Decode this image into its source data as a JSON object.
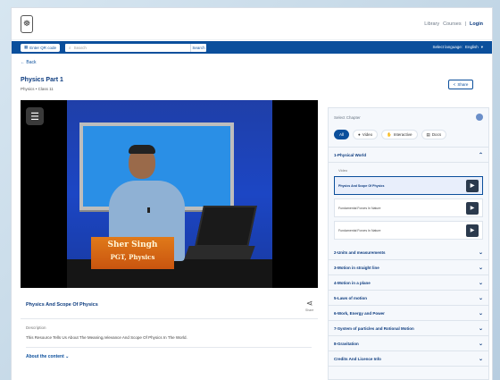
{
  "header": {
    "emblem": "☸",
    "links": [
      "Library",
      "Courses"
    ],
    "login": "Login",
    "separator": "|"
  },
  "searchbar": {
    "qr_label": "Enter QR code",
    "search_placeholder": "Search",
    "search_button": "Search",
    "language_label": "Select language:",
    "language_value": "English"
  },
  "nav": {
    "back": "Back"
  },
  "content": {
    "title": "Physics Part 1",
    "subtitle": "Physics • Class 11",
    "share_label": "Share"
  },
  "video": {
    "overlay_name": "Sher Singh",
    "overlay_role": "PGT, Physics",
    "title": "Physics And Scope Of Physics",
    "share_small": "Share",
    "description_label": "Description",
    "description_text": "This Resource Tells Us About The Meaning,relevance And Scope Of Physics In The World.",
    "about_label": "About the content"
  },
  "panel": {
    "select_label": "Select Chapter",
    "filters": [
      "All",
      "Video",
      "Interactive",
      "Docs"
    ],
    "open_chapter": "1-Physical World",
    "sub_label": "Video",
    "resources": [
      "Physics And Scope Of Physics",
      "Fundamental Forces In Nature",
      "Fundamental Forces In Nature"
    ],
    "chapters": [
      "2-Units and measurements",
      "3-Motion in straight line",
      "4-Motion in a plane",
      "5-Laws of motion",
      "6-Work, Energy and Power",
      "7-System of particles and Rotional Motion",
      "8-Gravitation",
      "Credits And Licence Info"
    ]
  },
  "colors": {
    "brand": "#0b4f9c",
    "title": "#0b3a7e"
  }
}
